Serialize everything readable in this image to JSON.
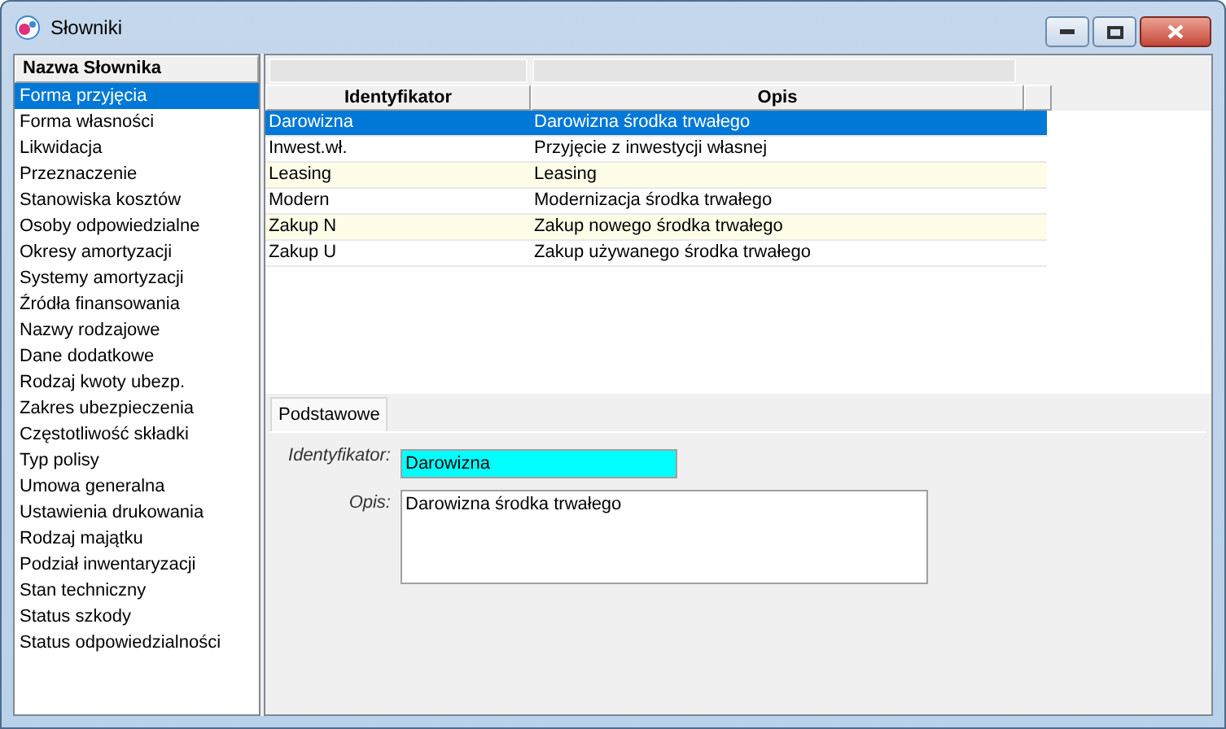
{
  "window": {
    "title": "Słowniki"
  },
  "dictionaries": {
    "header": "Nazwa Słownika",
    "items": [
      {
        "label": "Forma przyjęcia",
        "selected": true
      },
      {
        "label": "Forma własności",
        "selected": false
      },
      {
        "label": "Likwidacja",
        "selected": false
      },
      {
        "label": "Przeznaczenie",
        "selected": false
      },
      {
        "label": "Stanowiska kosztów",
        "selected": false
      },
      {
        "label": "Osoby odpowiedzialne",
        "selected": false
      },
      {
        "label": "Okresy amortyzacji",
        "selected": false
      },
      {
        "label": "Systemy amortyzacji",
        "selected": false
      },
      {
        "label": "Źródła finansowania",
        "selected": false
      },
      {
        "label": "Nazwy rodzajowe",
        "selected": false
      },
      {
        "label": "Dane dodatkowe",
        "selected": false
      },
      {
        "label": "Rodzaj kwoty ubezp.",
        "selected": false
      },
      {
        "label": "Zakres ubezpieczenia",
        "selected": false
      },
      {
        "label": "Częstotliwość składki",
        "selected": false
      },
      {
        "label": "Typ polisy",
        "selected": false
      },
      {
        "label": "Umowa generalna",
        "selected": false
      },
      {
        "label": "Ustawienia drukowania",
        "selected": false
      },
      {
        "label": "Rodzaj majątku",
        "selected": false
      },
      {
        "label": "Podział inwentaryzacji",
        "selected": false
      },
      {
        "label": "Stan techniczny",
        "selected": false
      },
      {
        "label": "Status szkody",
        "selected": false
      },
      {
        "label": "Status odpowiedzialności",
        "selected": false
      }
    ]
  },
  "table": {
    "columns": [
      "Identyfikator",
      "Opis"
    ],
    "rows": [
      {
        "cells": [
          "Darowizna",
          "Darowizna środka trwałego"
        ],
        "selected": true
      },
      {
        "cells": [
          "Inwest.wł.",
          "Przyjęcie z inwestycji własnej"
        ],
        "selected": false
      },
      {
        "cells": [
          "Leasing",
          "Leasing"
        ],
        "selected": false
      },
      {
        "cells": [
          "Modern",
          "Modernizacja środka trwałego"
        ],
        "selected": false
      },
      {
        "cells": [
          "Zakup N",
          "Zakup nowego środka trwałego"
        ],
        "selected": false
      },
      {
        "cells": [
          "Zakup U",
          "Zakup używanego środka trwałego"
        ],
        "selected": false
      }
    ]
  },
  "tabs": [
    {
      "label": "Podstawowe",
      "selected": true
    }
  ],
  "form": {
    "id_label": "Identyfikator:",
    "id_value": "Darowizna",
    "desc_label": "Opis:",
    "desc_value": "Darowizna środka trwałego"
  }
}
